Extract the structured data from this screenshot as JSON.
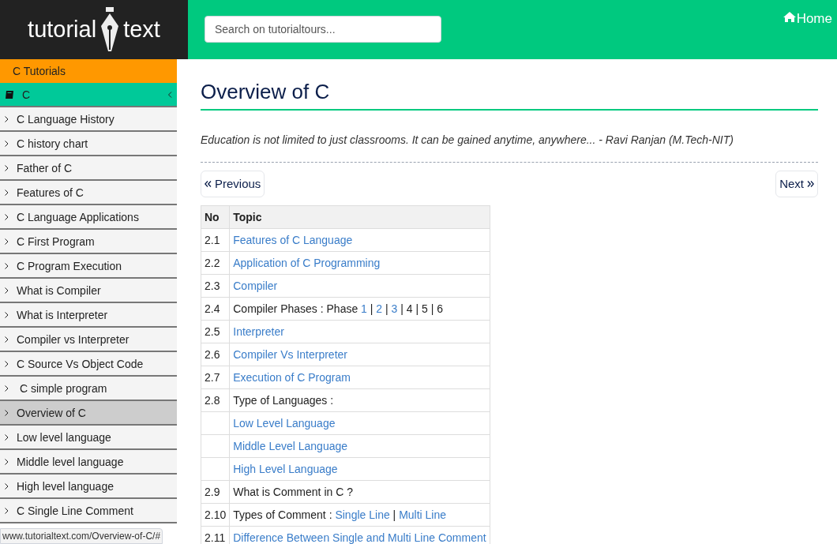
{
  "logo": {
    "left": "tutorial",
    "right": "text"
  },
  "search": {
    "placeholder": "Search on tutorialtours..."
  },
  "nav": {
    "home": "Home"
  },
  "sidebar": {
    "section": "C Tutorials",
    "group": {
      "label": "C",
      "expanded": true
    },
    "items": [
      {
        "label": "C Language History",
        "selected": false
      },
      {
        "label": "C history chart",
        "selected": false
      },
      {
        "label": "Father of C",
        "selected": false
      },
      {
        "label": "Features of C",
        "selected": false
      },
      {
        "label": "C Language Applications",
        "selected": false
      },
      {
        "label": "C First Program",
        "selected": false
      },
      {
        "label": "C Program Execution",
        "selected": false
      },
      {
        "label": "What is Compiler",
        "selected": false
      },
      {
        "label": "What is Interpreter",
        "selected": false
      },
      {
        "label": "Compiler vs Interpreter",
        "selected": false
      },
      {
        "label": "C Source Vs Object Code",
        "selected": false
      },
      {
        "label": " C simple program",
        "selected": false
      },
      {
        "label": "Overview of C",
        "selected": true
      },
      {
        "label": "Low level language",
        "selected": false
      },
      {
        "label": "Middle level language",
        "selected": false
      },
      {
        "label": "High level language",
        "selected": false
      },
      {
        "label": "C Single Line Comment",
        "selected": false
      }
    ]
  },
  "page": {
    "title": "Overview of C",
    "quote": "Education is not limited to just classrooms. It can be gained anytime, anywhere... - Ravi Ranjan (M.Tech-NIT)",
    "previous": "Previous",
    "next": "Next"
  },
  "table": {
    "columns": [
      "No",
      "Topic"
    ],
    "rows": [
      {
        "no": "2.1",
        "topic": [
          {
            "kind": "link",
            "text": "Features of C Language"
          }
        ]
      },
      {
        "no": "2.2",
        "topic": [
          {
            "kind": "link",
            "text": "Application of C Programming"
          }
        ]
      },
      {
        "no": "2.3",
        "topic": [
          {
            "kind": "link",
            "text": "Compiler"
          }
        ]
      },
      {
        "no": "2.4",
        "topic": [
          {
            "kind": "text",
            "text": "Compiler Phases : Phase"
          },
          {
            "kind": "link",
            "text": "1"
          },
          {
            "kind": "text",
            "text": "|"
          },
          {
            "kind": "link",
            "text": "2"
          },
          {
            "kind": "text",
            "text": "|"
          },
          {
            "kind": "link",
            "text": "3"
          },
          {
            "kind": "text",
            "text": "|"
          },
          {
            "kind": "text",
            "text": "4"
          },
          {
            "kind": "text",
            "text": "|"
          },
          {
            "kind": "text",
            "text": "5"
          },
          {
            "kind": "text",
            "text": "|"
          },
          {
            "kind": "text",
            "text": "6"
          }
        ]
      },
      {
        "no": "2.5",
        "topic": [
          {
            "kind": "link",
            "text": "Interpreter"
          }
        ]
      },
      {
        "no": "2.6",
        "topic": [
          {
            "kind": "link",
            "text": "Compiler Vs Interpreter"
          }
        ]
      },
      {
        "no": "2.7",
        "topic": [
          {
            "kind": "link",
            "text": "Execution of C Program"
          }
        ]
      },
      {
        "no": "2.8",
        "topic": [
          {
            "kind": "text",
            "text": "Type of Languages :"
          }
        ]
      },
      {
        "topic": [
          {
            "kind": "link",
            "text": "Low Level Language"
          }
        ]
      },
      {
        "topic": [
          {
            "kind": "link",
            "text": "Middle Level Language"
          }
        ]
      },
      {
        "topic": [
          {
            "kind": "link",
            "text": "High Level Language"
          }
        ]
      },
      {
        "no": "2.9",
        "topic": [
          {
            "kind": "text",
            "text": "What is Comment in C ?"
          }
        ]
      },
      {
        "no": "2.10",
        "topic": [
          {
            "kind": "text",
            "text": "Types of Comment :"
          },
          {
            "kind": "link",
            "text": "Single Line"
          },
          {
            "kind": "text",
            "text": "|"
          },
          {
            "kind": "link",
            "text": "Multi Line"
          }
        ]
      },
      {
        "no": "2.11",
        "topic": [
          {
            "kind": "link",
            "text": "Difference Between Single and Multi Line Comment"
          }
        ]
      }
    ]
  },
  "status_bar": {
    "url": "www.tutorialtext.com/Overview-of-C/#"
  }
}
